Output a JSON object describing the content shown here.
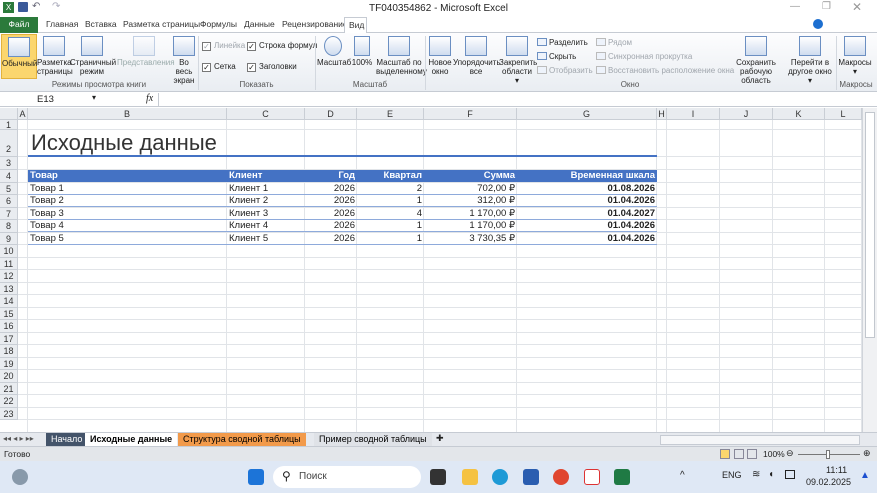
{
  "window": {
    "title": "TF040354862 - Microsoft Excel"
  },
  "ribbon_tabs": [
    "Файл",
    "Главная",
    "Вставка",
    "Разметка страницы",
    "Формулы",
    "Данные",
    "Рецензирование",
    "Вид"
  ],
  "ribbon": {
    "views": {
      "normal": "Обычный",
      "page_layout_1": "Разметка",
      "page_layout_2": "страницы",
      "page_break_1": "Страничный",
      "page_break_2": "режим",
      "custom": "Представления",
      "full_1": "Во весь",
      "full_2": "экран",
      "group": "Режимы просмотра книги"
    },
    "show": {
      "ruler": "Линейка",
      "formula_bar": "Строка формул",
      "gridlines": "Сетка",
      "headings": "Заголовки",
      "group": "Показать"
    },
    "zoom": {
      "zoom": "Масштаб",
      "z100": "100%",
      "sel_1": "Масштаб по",
      "sel_2": "выделенному",
      "group": "Масштаб"
    },
    "window": {
      "new_1": "Новое",
      "new_2": "окно",
      "arrange_1": "Упорядочить",
      "arrange_2": "все",
      "freeze_1": "Закрепить",
      "freeze_2": "области",
      "split": "Разделить",
      "hide": "Скрыть",
      "unhide": "Отобразить",
      "side": "Рядом",
      "sync": "Синхронная прокрутка",
      "reset": "Восстановить расположение окна",
      "save_1": "Сохранить",
      "save_2": "рабочую область",
      "switch_1": "Перейти в",
      "switch_2": "другое окно",
      "group": "Окно"
    },
    "macros": {
      "label": "Макросы",
      "group": "Макросы"
    }
  },
  "formula_bar": {
    "name_box": "E13",
    "fx": "fx",
    "value": ""
  },
  "columns": [
    "A",
    "B",
    "C",
    "D",
    "E",
    "F",
    "G",
    "H",
    "I",
    "J",
    "K",
    "L"
  ],
  "rows": [
    "1",
    "2",
    "3",
    "4",
    "5",
    "6",
    "7",
    "8",
    "9",
    "10",
    "11",
    "12",
    "13",
    "14",
    "15",
    "16",
    "17",
    "18",
    "19",
    "20",
    "21",
    "22",
    "23"
  ],
  "sheet": {
    "title": "Исходные данные",
    "headers": [
      "Товар",
      "Клиент",
      "Год",
      "Квартал",
      "Сумма",
      "Временная шкала"
    ],
    "data": [
      [
        "Товар 1",
        "Клиент 1",
        "2026",
        "2",
        "702,00 ₽",
        "01.08.2026"
      ],
      [
        "Товар 2",
        "Клиент 2",
        "2026",
        "1",
        "312,00 ₽",
        "01.04.2026"
      ],
      [
        "Товар 3",
        "Клиент 3",
        "2026",
        "4",
        "1 170,00 ₽",
        "01.04.2027"
      ],
      [
        "Товар 4",
        "Клиент 4",
        "2026",
        "1",
        "1 170,00 ₽",
        "01.04.2026"
      ],
      [
        "Товар 5",
        "Клиент 5",
        "2026",
        "1",
        "3 730,35 ₽",
        "01.04.2026"
      ]
    ]
  },
  "sheet_tabs": [
    "Начало",
    "Исходные данные",
    "Структура сводной таблицы",
    "Пример сводной таблицы"
  ],
  "status": {
    "ready": "Готово",
    "zoom": "100%"
  },
  "taskbar": {
    "search": "Поиск",
    "lang": "ENG",
    "time": "11:11",
    "date": "09.02.2025"
  },
  "colors": {
    "accent": "#4472c4",
    "file_tab": "#2b7a3b",
    "orange_tab": "#f29a4a"
  }
}
